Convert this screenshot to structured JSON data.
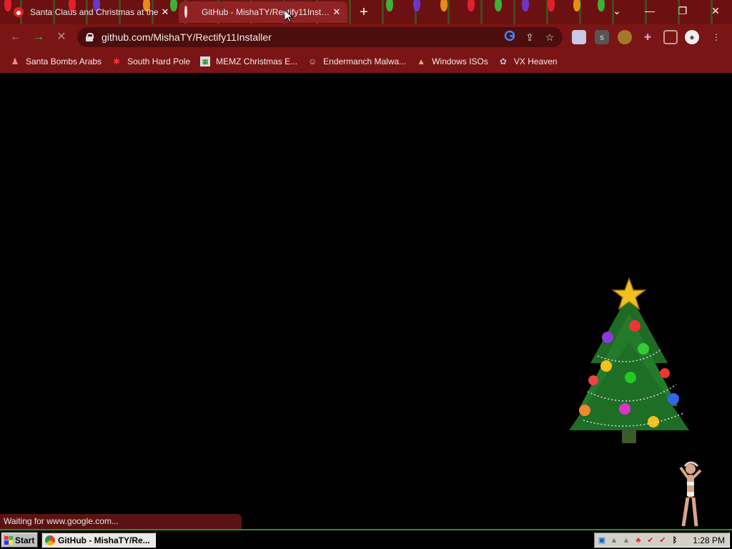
{
  "browser": {
    "tabs": [
      {
        "title": "Santa Claus and Christmas at the",
        "active": false
      },
      {
        "title": "GitHub - MishaTY/Rectify11Installer",
        "active": true
      }
    ],
    "url": "github.com/MishaTY/Rectify11Installer",
    "bookmarks": [
      {
        "label": "Santa Bombs Arabs",
        "icon": "santa-icon"
      },
      {
        "label": "South Hard Pole",
        "icon": "snowflake-icon"
      },
      {
        "label": "MEMZ Christmas E...",
        "icon": "memz-icon"
      },
      {
        "label": "Endermanch Malwa...",
        "icon": "endermanch-icon"
      },
      {
        "label": "Windows ISOs",
        "icon": "tree-icon"
      },
      {
        "label": "VX Heaven",
        "icon": "vx-icon"
      }
    ],
    "status": "Waiting for www.google.com...",
    "colors": {
      "chrome": "#7a1515",
      "omnibox": "#4c0d0d",
      "accent_green": "#2e8b2e"
    }
  },
  "taskbar": {
    "start_label": "Start",
    "task_label": "GitHub - MishaTY/Re...",
    "clock": "1:28 PM"
  }
}
